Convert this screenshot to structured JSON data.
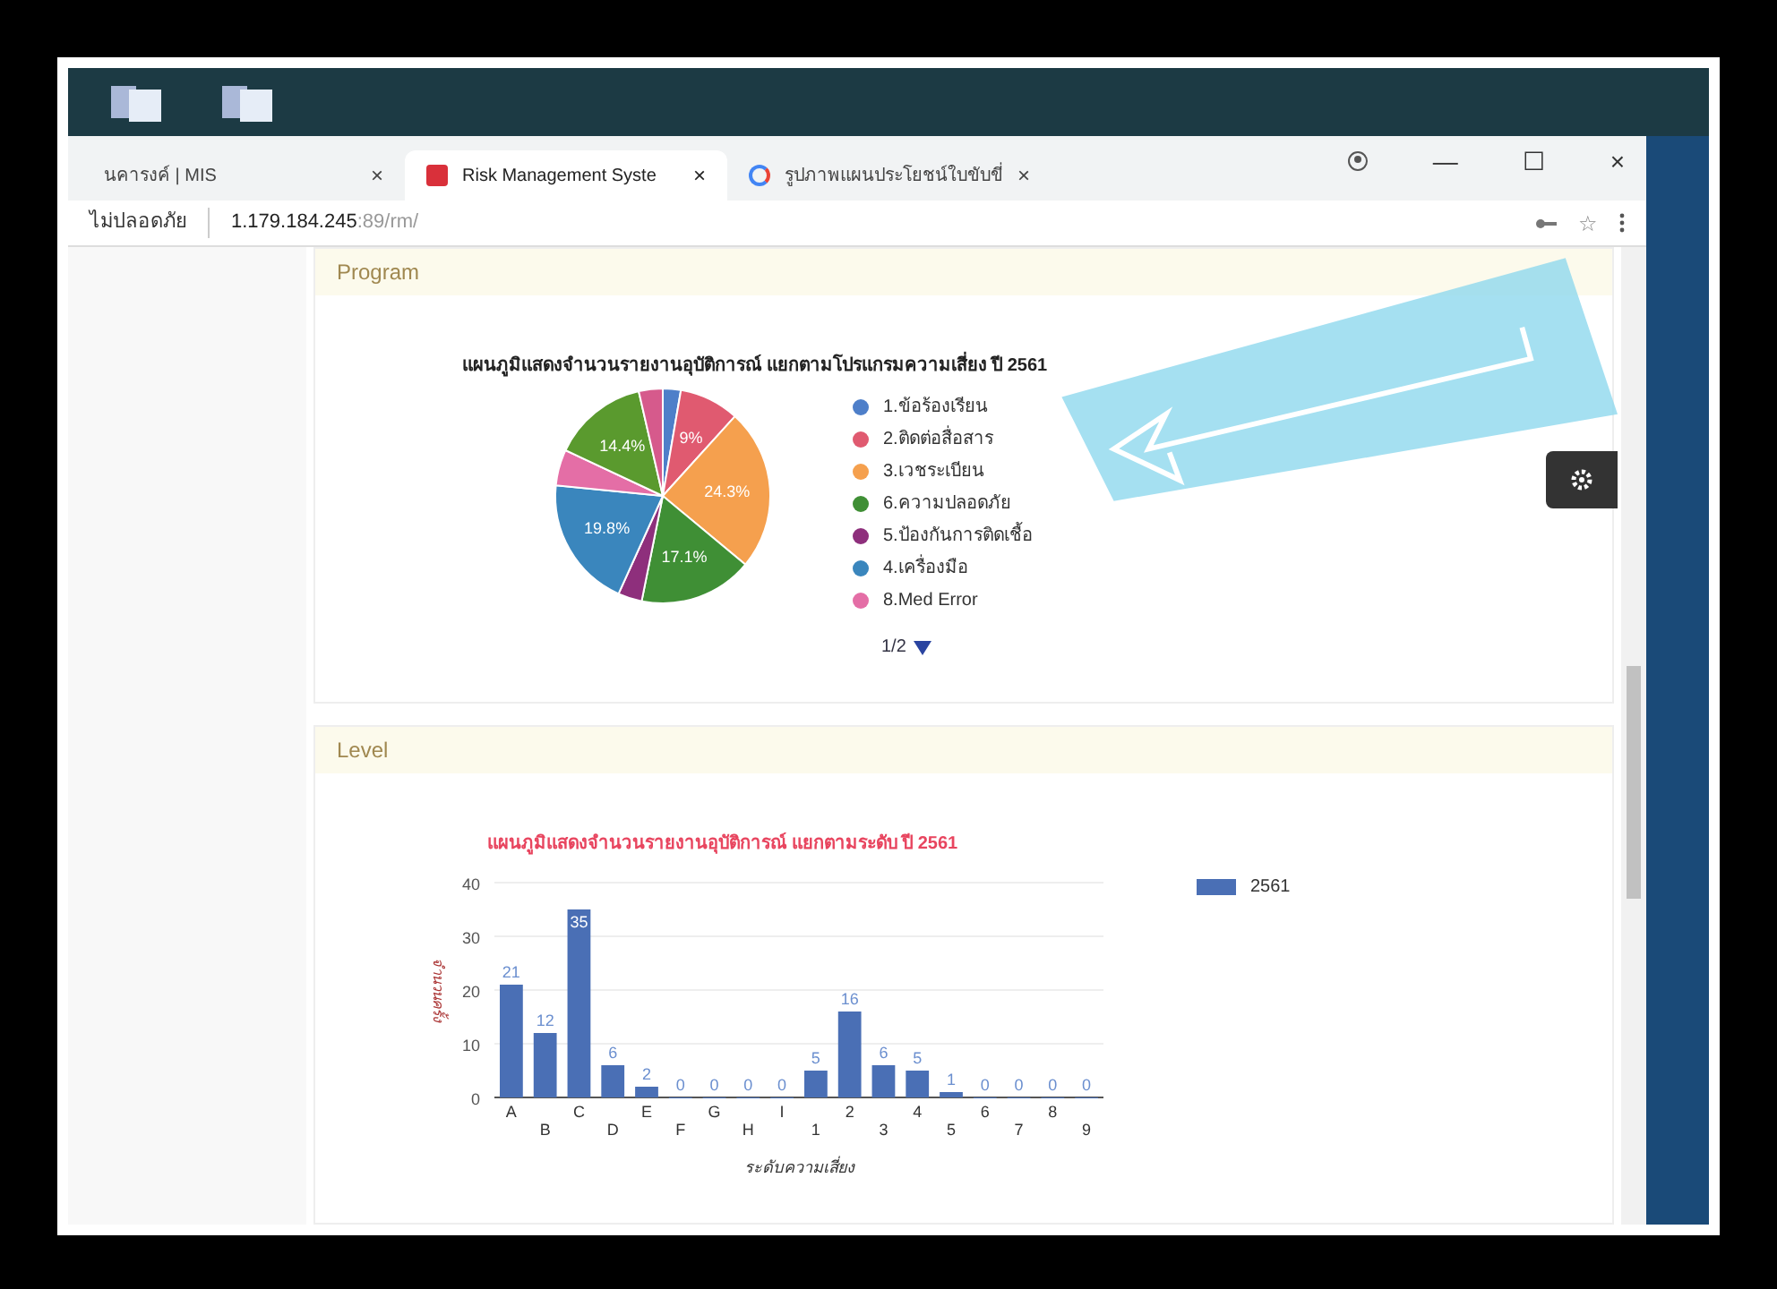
{
  "tabs": [
    {
      "label": "นคารงค์ | MIS",
      "close": "×",
      "selected": false,
      "kind": "plain"
    },
    {
      "label": "Risk Management Syste",
      "close": "×",
      "selected": true,
      "kind": "alert"
    },
    {
      "label": "รูปภาพแผนประโยชน์ใบขับขี่",
      "close": "×",
      "selected": false,
      "kind": "google"
    }
  ],
  "window_controls": {
    "minimize": "—",
    "maximize": "☐",
    "close": "×"
  },
  "address_bar": {
    "security": "ไม่ปลอดภัย",
    "host": "1.179.184.245",
    "path": ":89/rm/",
    "bookmark": "☆"
  },
  "sections": [
    {
      "title": "Program",
      "pie": {
        "chart_data": {
          "type": "pie",
          "title": "แผนภูมิแสดงจำนวนรายงานอุบัติการณ์ แยกตามโปรแกรมความเสี่ยง ปี 2561",
          "values": [
            2.7,
            9,
            24.3,
            17.1,
            3.6,
            19.8,
            5.4,
            14.4,
            3.6
          ],
          "colors": [
            "#4e7fc9",
            "#e05a70",
            "#f5a04e",
            "#3f8f35",
            "#8e2f7c",
            "#3a86bd",
            "#e46ea6",
            "#5a9a2e",
            "#d65a8c"
          ],
          "value_labels": [
            null,
            "9%",
            "24.3%",
            "17.1%",
            null,
            "19.8%",
            null,
            "14.4%",
            null
          ]
        },
        "legend": [
          {
            "label": "1.ข้อร้องเรียน",
            "color": "#4e7fc9"
          },
          {
            "label": "2.ติดต่อสื่อสาร",
            "color": "#e05a70"
          },
          {
            "label": "3.เวชระเบียน",
            "color": "#f5a04e"
          },
          {
            "label": "6.ความปลอดภัย",
            "color": "#3f8f35"
          },
          {
            "label": "5.ป้องกันการติดเชื้อ",
            "color": "#8e2f7c"
          },
          {
            "label": "4.เครื่องมือ",
            "color": "#3a86bd"
          },
          {
            "label": "8.Med Error",
            "color": "#e46ea6"
          }
        ],
        "legend_page": "1/2"
      }
    },
    {
      "title": "Level",
      "chart_data": {
        "type": "bar",
        "title": "แผนภูมิแสดงจำนวนรายงานอุบัติการณ์ แยกตามระดับ ปี 2561",
        "xlabel": "ระดับความเสี่ยง",
        "ylabel": "จำนวนครั้ง",
        "categories": [
          "A",
          "B",
          "C",
          "D",
          "E",
          "F",
          "G",
          "H",
          "I",
          "1",
          "2",
          "3",
          "4",
          "5",
          "6",
          "7",
          "8",
          "9"
        ],
        "series": [
          {
            "name": "2561",
            "color": "#4a6fb5",
            "values": [
              21,
              12,
              35,
              6,
              2,
              0,
              0,
              0,
              0,
              5,
              16,
              6,
              5,
              1,
              0,
              0,
              0,
              0
            ]
          }
        ],
        "ylim": [
          0,
          40
        ],
        "yticks": [
          0,
          10,
          20,
          30,
          40
        ],
        "grid": true,
        "data_labels": true
      }
    }
  ]
}
